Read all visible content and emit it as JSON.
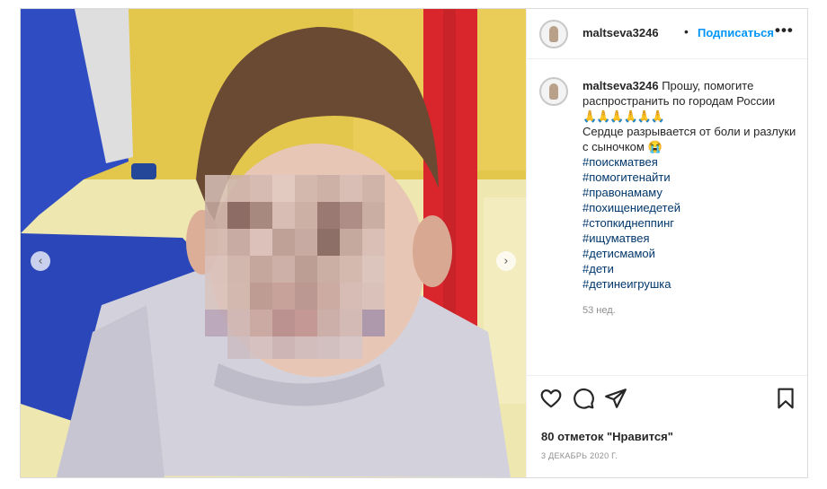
{
  "post": {
    "username": "maltseva3246",
    "dot": "•",
    "follow_label": "Подписаться",
    "more_label": "•••",
    "caption_user": "maltseva3246",
    "caption_line1": "Прошу, помогите распространить по городам России",
    "caption_emoji": "🙏🙏🙏🙏🙏🙏",
    "caption_line2": "Сердце разрывается от боли и разлуки с сыночком 😭",
    "hashtags": [
      "#поискматвея",
      "#помогитенайти",
      "#правонамаму",
      "#похищениедетей",
      "#стопкиднеппинг",
      "#ищуматвея",
      "#детисмамой",
      "#дети",
      "#детинеигрушка"
    ],
    "age": "53 нед.",
    "likes": "80 отметок \"Нравится\"",
    "date": "3 ДЕКАБРЬ 2020 Г."
  },
  "icons": {
    "like": "heart-icon",
    "comment": "comment-icon",
    "share": "share-icon",
    "save": "bookmark-icon",
    "prev": "chevron-left-icon",
    "next": "chevron-right-icon"
  },
  "nav": {
    "prev_glyph": "‹",
    "next_glyph": "›"
  }
}
